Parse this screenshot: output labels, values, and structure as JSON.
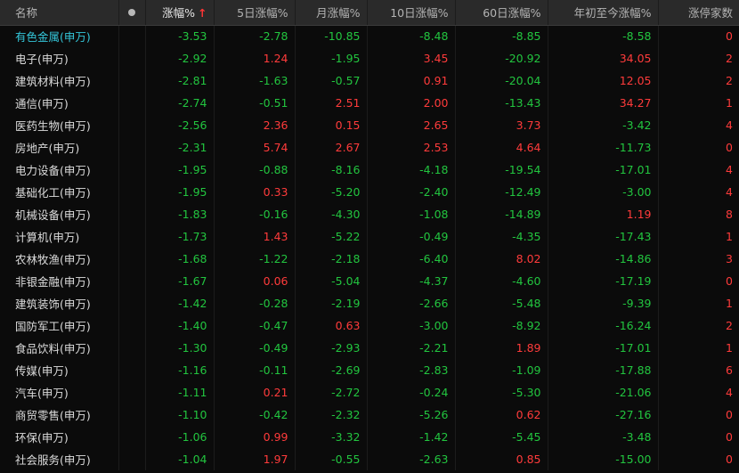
{
  "headers": {
    "name": "名称",
    "dot": "●",
    "change": "涨幅%",
    "sort_arrow": "↑",
    "change_5d": "5日涨幅%",
    "change_month": "月涨幅%",
    "change_10d": "10日涨幅%",
    "change_60d": "60日涨幅%",
    "change_ytd": "年初至今涨幅%",
    "limit_up_count": "涨停家数"
  },
  "colors": {
    "up": "#ff3b3b",
    "down": "#22c53f",
    "selected": "#34c6d9",
    "header_bg": "#2a2a2a",
    "background": "#0b0b0b"
  },
  "rows": [
    {
      "name": "有色金属(申万)",
      "change": "-3.53",
      "change_5d": "-2.78",
      "change_month": "-10.85",
      "change_10d": "-8.48",
      "change_60d": "-8.85",
      "change_ytd": "-8.58",
      "limit_up": "0"
    },
    {
      "name": "电子(申万)",
      "change": "-2.92",
      "change_5d": "1.24",
      "change_month": "-1.95",
      "change_10d": "3.45",
      "change_60d": "-20.92",
      "change_ytd": "34.05",
      "limit_up": "2"
    },
    {
      "name": "建筑材料(申万)",
      "change": "-2.81",
      "change_5d": "-1.63",
      "change_month": "-0.57",
      "change_10d": "0.91",
      "change_60d": "-20.04",
      "change_ytd": "12.05",
      "limit_up": "2"
    },
    {
      "name": "通信(申万)",
      "change": "-2.74",
      "change_5d": "-0.51",
      "change_month": "2.51",
      "change_10d": "2.00",
      "change_60d": "-13.43",
      "change_ytd": "34.27",
      "limit_up": "1"
    },
    {
      "name": "医药生物(申万)",
      "change": "-2.56",
      "change_5d": "2.36",
      "change_month": "0.15",
      "change_10d": "2.65",
      "change_60d": "3.73",
      "change_ytd": "-3.42",
      "limit_up": "4"
    },
    {
      "name": "房地产(申万)",
      "change": "-2.31",
      "change_5d": "5.74",
      "change_month": "2.67",
      "change_10d": "2.53",
      "change_60d": "4.64",
      "change_ytd": "-11.73",
      "limit_up": "0"
    },
    {
      "name": "电力设备(申万)",
      "change": "-1.95",
      "change_5d": "-0.88",
      "change_month": "-8.16",
      "change_10d": "-4.18",
      "change_60d": "-19.54",
      "change_ytd": "-17.01",
      "limit_up": "4"
    },
    {
      "name": "基础化工(申万)",
      "change": "-1.95",
      "change_5d": "0.33",
      "change_month": "-5.20",
      "change_10d": "-2.40",
      "change_60d": "-12.49",
      "change_ytd": "-3.00",
      "limit_up": "4"
    },
    {
      "name": "机械设备(申万)",
      "change": "-1.83",
      "change_5d": "-0.16",
      "change_month": "-4.30",
      "change_10d": "-1.08",
      "change_60d": "-14.89",
      "change_ytd": "1.19",
      "limit_up": "8"
    },
    {
      "name": "计算机(申万)",
      "change": "-1.73",
      "change_5d": "1.43",
      "change_month": "-5.22",
      "change_10d": "-0.49",
      "change_60d": "-4.35",
      "change_ytd": "-17.43",
      "limit_up": "1"
    },
    {
      "name": "农林牧渔(申万)",
      "change": "-1.68",
      "change_5d": "-1.22",
      "change_month": "-2.18",
      "change_10d": "-6.40",
      "change_60d": "8.02",
      "change_ytd": "-14.86",
      "limit_up": "3"
    },
    {
      "name": "非银金融(申万)",
      "change": "-1.67",
      "change_5d": "0.06",
      "change_month": "-5.04",
      "change_10d": "-4.37",
      "change_60d": "-4.60",
      "change_ytd": "-17.19",
      "limit_up": "0"
    },
    {
      "name": "建筑装饰(申万)",
      "change": "-1.42",
      "change_5d": "-0.28",
      "change_month": "-2.19",
      "change_10d": "-2.66",
      "change_60d": "-5.48",
      "change_ytd": "-9.39",
      "limit_up": "1"
    },
    {
      "name": "国防军工(申万)",
      "change": "-1.40",
      "change_5d": "-0.47",
      "change_month": "0.63",
      "change_10d": "-3.00",
      "change_60d": "-8.92",
      "change_ytd": "-16.24",
      "limit_up": "2"
    },
    {
      "name": "食品饮料(申万)",
      "change": "-1.30",
      "change_5d": "-0.49",
      "change_month": "-2.93",
      "change_10d": "-2.21",
      "change_60d": "1.89",
      "change_ytd": "-17.01",
      "limit_up": "1"
    },
    {
      "name": "传媒(申万)",
      "change": "-1.16",
      "change_5d": "-0.11",
      "change_month": "-2.69",
      "change_10d": "-2.83",
      "change_60d": "-1.09",
      "change_ytd": "-17.88",
      "limit_up": "6"
    },
    {
      "name": "汽车(申万)",
      "change": "-1.11",
      "change_5d": "0.21",
      "change_month": "-2.72",
      "change_10d": "-0.24",
      "change_60d": "-5.30",
      "change_ytd": "-21.06",
      "limit_up": "4"
    },
    {
      "name": "商贸零售(申万)",
      "change": "-1.10",
      "change_5d": "-0.42",
      "change_month": "-2.32",
      "change_10d": "-5.26",
      "change_60d": "0.62",
      "change_ytd": "-27.16",
      "limit_up": "0"
    },
    {
      "name": "环保(申万)",
      "change": "-1.06",
      "change_5d": "0.99",
      "change_month": "-3.32",
      "change_10d": "-1.42",
      "change_60d": "-5.45",
      "change_ytd": "-3.48",
      "limit_up": "0"
    },
    {
      "name": "社会服务(申万)",
      "change": "-1.04",
      "change_5d": "1.97",
      "change_month": "-0.55",
      "change_10d": "-2.63",
      "change_60d": "0.85",
      "change_ytd": "-15.00",
      "limit_up": "0"
    }
  ]
}
